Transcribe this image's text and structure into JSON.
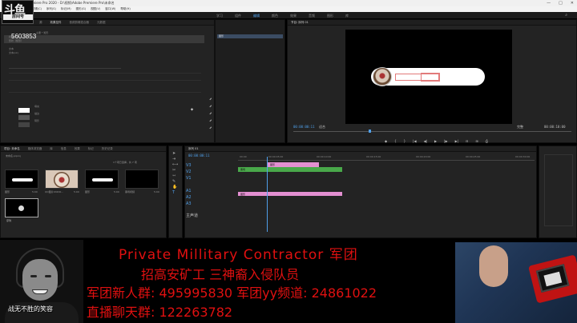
{
  "window": {
    "title": "Adobe Premiere Pro 2020 - D:\\视频\\Adobe Premiere Pro\\未命名",
    "controls": [
      "—",
      "□",
      "✕"
    ]
  },
  "menu": [
    "文件(F)",
    "编辑(E)",
    "剪辑(C)",
    "序列(S)",
    "标记(M)",
    "图形(G)",
    "视图(V)",
    "窗口(W)",
    "帮助(H)"
  ],
  "workspaces": {
    "tabs": [
      "学习",
      "组件",
      "编辑",
      "颜色",
      "效果",
      "音频",
      "图形",
      "库"
    ],
    "active": "编辑"
  },
  "stream": {
    "logo_mark": "斗鱼",
    "room_label": "房间号",
    "room_number": "5603853"
  },
  "effect_controls": {
    "tabs": [
      "源",
      "效果控件",
      "音频剪辑混合器",
      "元数据"
    ],
    "rows": [
      "主要 * 矩形",
      "视频",
      "形状（矩形）",
      "",
      "文本",
      "",
      "矢量运动"
    ],
    "sublabel": "文本(ok)",
    "swatch_labels": [
      "填充",
      "描边",
      "阴影"
    ]
  },
  "source_list": {
    "items": [
      "图形"
    ]
  },
  "program_monitor": {
    "title": "节目: 序列 01",
    "timecode_left": "00:00:00:11",
    "fit": "适合",
    "quality": "完整",
    "timecode_right": "00:00:10:00",
    "controls": [
      "◆",
      "{",
      "}",
      "|◀",
      "◀|",
      "▶",
      "|▶",
      "▶|",
      "⊟",
      "⊞",
      "⎙"
    ]
  },
  "project": {
    "tabs": [
      "项目: 未命名",
      "媒体浏览器",
      "库",
      "信息",
      "效果",
      "标记",
      "历史记录"
    ],
    "path": "未命名.prproj",
    "search_hint": "1个项已选择，共 7 项",
    "items": [
      {
        "label": "图形",
        "duration": "5:00"
      },
      {
        "label": "QQ图片20200...",
        "duration": "5:00"
      },
      {
        "label": "图形",
        "duration": "5:00"
      },
      {
        "label": "黑场视频",
        "duration": "5:00"
      },
      {
        "label": "序列",
        "duration": ""
      }
    ]
  },
  "timeline": {
    "title": "序列 01",
    "timecode": "00:00:00:11",
    "ruler": [
      "00:00",
      "00:00:05:00",
      "00:00:10:00",
      "00:00:15:00",
      "00:00:20:00",
      "00:00:25:00",
      "00:00:30:00"
    ],
    "tracks": [
      "V3",
      "V2",
      "V1",
      "A1",
      "A2",
      "A3",
      "主声道"
    ],
    "clips": [
      {
        "label": "图形",
        "track": "V3"
      },
      {
        "label": "黑场",
        "track": "V2"
      },
      {
        "label": "图形",
        "track": "V1"
      }
    ]
  },
  "overlay": {
    "cam_caption": "战无不胜的笑容",
    "line1": "Private  Millitary  Contractor  军团",
    "line2": "招高安矿工     三神裔入侵队员",
    "line3": "军团新人群: 495995830  军团yy频道: 24861022",
    "line4": "直播聊天群: 122263782"
  },
  "colors": {
    "accent": "#4f9fe9",
    "overlay_red": "#e01010",
    "clip_green": "#49a84a",
    "clip_pink": "#e38fd1"
  }
}
